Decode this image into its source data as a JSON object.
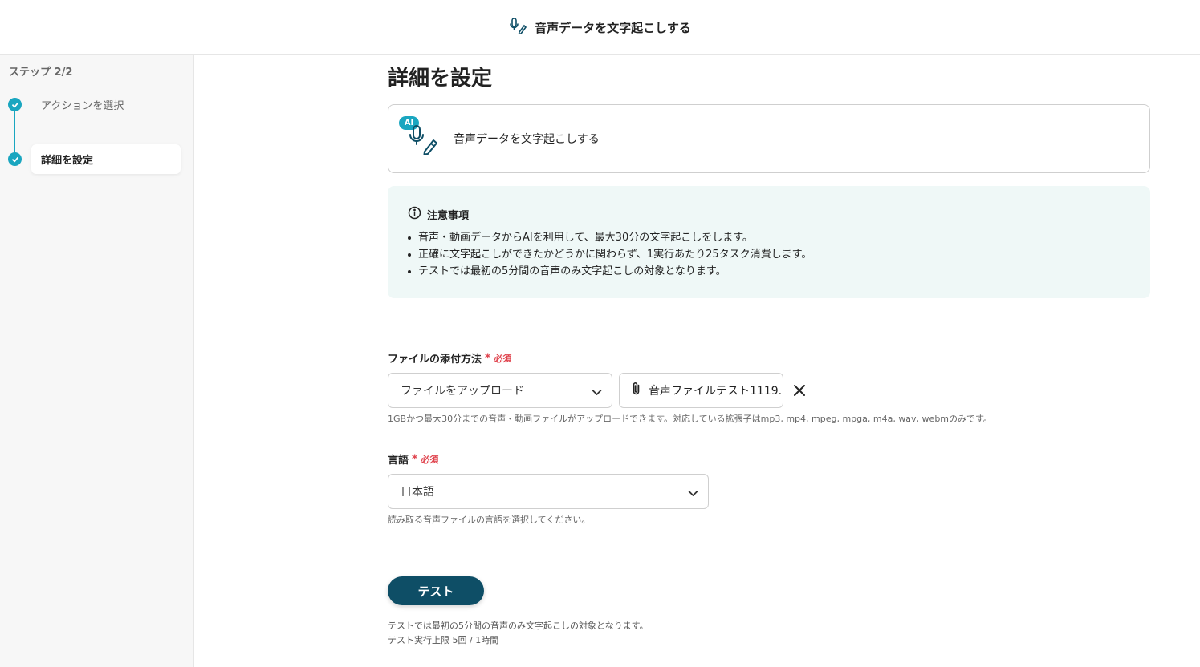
{
  "header": {
    "title": "音声データを文字起こしする",
    "icon": "mic-pen-icon"
  },
  "sidebar": {
    "step_indicator": "ステップ 2/2",
    "steps": [
      {
        "label": "アクションを選択",
        "completed": true,
        "active": false
      },
      {
        "label": "詳細を設定",
        "completed": true,
        "active": true
      }
    ]
  },
  "main": {
    "title": "詳細を設定",
    "action_card": {
      "badge": "AI",
      "label": "音声データを文字起こしする",
      "icon": "mic-pen-icon"
    },
    "notice": {
      "title": "注意事項",
      "icon": "info-icon",
      "items": [
        "音声・動画データからAIを利用して、最大30分の文字起こしをします。",
        "正確に文字起こしができたかどうかに関わらず、1実行あたり25タスク消費します。",
        "テストでは最初の5分間の音声のみ文字起こしの対象となります。"
      ]
    },
    "attach_method": {
      "label": "ファイルの添付方法",
      "required_star": "*",
      "required_text": "必須",
      "selected": "ファイルをアップロード",
      "file_name": "音声ファイルテスト1119...",
      "help": "1GBかつ最大30分までの音声・動画ファイルがアップロードできます。対応している拡張子はmp3, mp4, mpeg, mpga, m4a, wav, webmのみです。"
    },
    "language": {
      "label": "言語",
      "required_star": "*",
      "required_text": "必須",
      "selected": "日本語",
      "help": "読み取る音声ファイルの言語を選択してください。"
    },
    "test_button": "テスト",
    "footer_notes": [
      "テストでは最初の5分間の音声のみ文字起こしの対象となります。",
      "テスト実行上限 5回 / 1時間"
    ]
  },
  "colors": {
    "accent": "#1aa6c0",
    "primary_button": "#0e4e66",
    "required": "#e0454f",
    "notice_bg": "#eff8f7"
  }
}
